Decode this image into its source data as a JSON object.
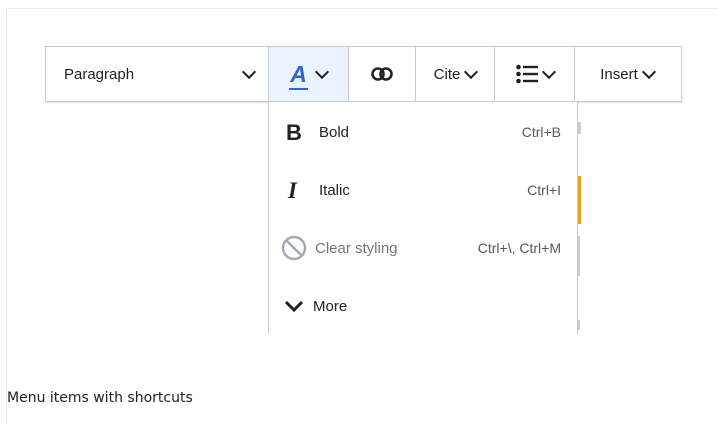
{
  "toolbar": {
    "paragraph_label": "Paragraph",
    "cite_label": "Cite",
    "insert_label": "Insert",
    "style_icon_letter": "A"
  },
  "menu": {
    "items": [
      {
        "icon": "bold-icon",
        "label": "Bold",
        "shortcut": "Ctrl+B",
        "disabled": false
      },
      {
        "icon": "italic-icon",
        "label": "Italic",
        "shortcut": "Ctrl+I",
        "disabled": false
      },
      {
        "icon": "clear-styling-icon",
        "label": "Clear styling",
        "shortcut": "Ctrl+\\, Ctrl+M",
        "disabled": true
      },
      {
        "icon": "chevron-down-icon",
        "label": "More",
        "shortcut": "",
        "disabled": false
      }
    ]
  },
  "caption": "Menu items with shortcuts",
  "colors": {
    "accent": "#36c",
    "active_bg": "#eaf3ff",
    "highlight": "#e9a31f",
    "border": "#c8ccd1"
  }
}
